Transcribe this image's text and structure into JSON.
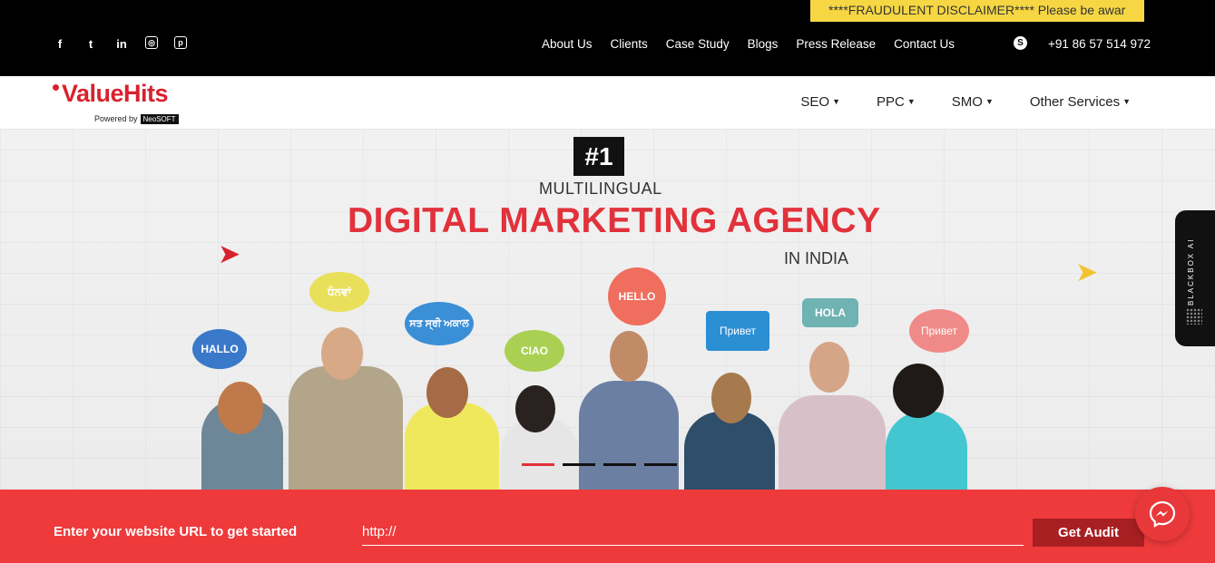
{
  "topbar": {
    "disclaimer": "****FRAUDULENT DISCLAIMER**** Please be awar",
    "social": [
      {
        "name": "facebook-icon",
        "glyph": "f"
      },
      {
        "name": "twitter-icon",
        "glyph": "t"
      },
      {
        "name": "linkedin-icon",
        "glyph": "in"
      },
      {
        "name": "instagram-icon",
        "glyph": "◎"
      },
      {
        "name": "pinterest-icon",
        "glyph": "p"
      }
    ],
    "nav": [
      "About Us",
      "Clients",
      "Case Study",
      "Blogs",
      "Press Release",
      "Contact Us"
    ],
    "phone": "+91 86 57 514 972"
  },
  "header": {
    "logo_text": "ValueHits",
    "logo_powered": "Powered by",
    "logo_brand": "NeoSOFT",
    "menu": [
      "SEO",
      "PPC",
      "SMO",
      "Other Services"
    ]
  },
  "hero": {
    "badge": "#1",
    "subtitle_top": "MULTILINGUAL",
    "headline": "DIGITAL MARKETING AGENCY",
    "subtitle_bottom": "IN INDIA",
    "bubbles": [
      "HALLO",
      "ਧੰਨਵਾਂ",
      "ਸਤ ਸ੍ਰੀ ਅਕਾਲ",
      "CIAO",
      "HELLO",
      "Привет",
      "HOLA",
      "Привет"
    ],
    "carousel_total": 4,
    "carousel_active": 1
  },
  "sidetab": {
    "label": "BLACKBOX AI"
  },
  "cta": {
    "label": "Enter your website URL to get started",
    "input_placeholder": "http://",
    "button": "Get Audit"
  },
  "colors": {
    "brand_red": "#e1323b",
    "cta_red": "#ee3a3b",
    "button_dark_red": "#a81f22",
    "ticker_yellow": "#f6d743"
  }
}
